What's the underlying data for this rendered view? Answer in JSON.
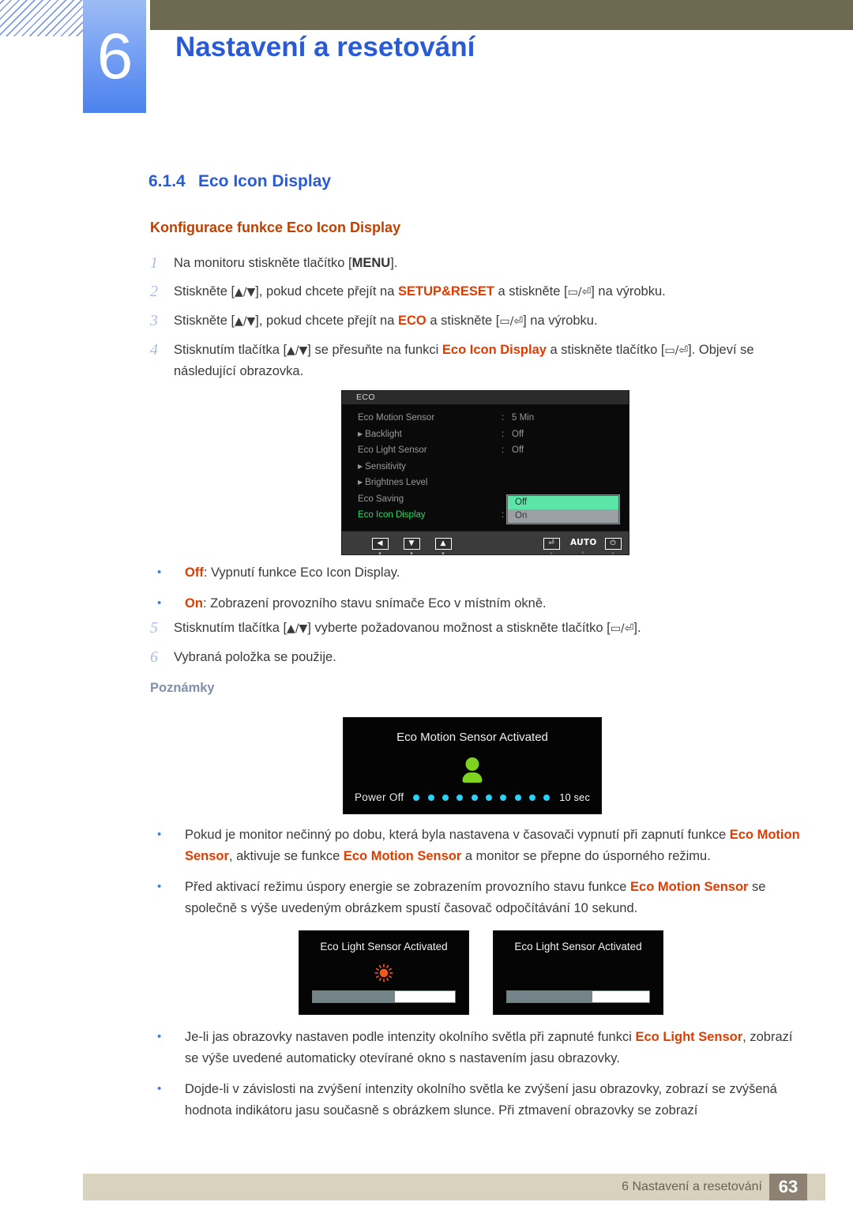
{
  "header": {
    "chapter_number": "6",
    "chapter_title": "Nastavení a resetování"
  },
  "section": {
    "number": "6.1.4",
    "title": "Eco Icon Display",
    "subtitle": "Konfigurace funkce Eco Icon Display"
  },
  "steps": [
    {
      "num": "1",
      "parts": [
        {
          "t": "Na monitoru stiskněte tlačítko [",
          "k": "plain"
        },
        {
          "t": "MENU",
          "k": "kb"
        },
        {
          "t": "].",
          "k": "plain"
        }
      ]
    },
    {
      "num": "2",
      "parts": [
        {
          "t": "Stiskněte [",
          "k": "plain"
        },
        {
          "t": "▲/▼",
          "k": "sym"
        },
        {
          "t": "], pokud chcete přejít na ",
          "k": "plain"
        },
        {
          "t": "SETUP&RESET",
          "k": "hl"
        },
        {
          "t": " a stiskněte [",
          "k": "plain"
        },
        {
          "t": "▭/⏎",
          "k": "sym"
        },
        {
          "t": "] na výrobku.",
          "k": "plain"
        }
      ]
    },
    {
      "num": "3",
      "parts": [
        {
          "t": "Stiskněte [",
          "k": "plain"
        },
        {
          "t": "▲/▼",
          "k": "sym"
        },
        {
          "t": "], pokud chcete přejít na ",
          "k": "plain"
        },
        {
          "t": "ECO",
          "k": "hl"
        },
        {
          "t": " a stiskněte [",
          "k": "plain"
        },
        {
          "t": "▭/⏎",
          "k": "sym"
        },
        {
          "t": "] na výrobku.",
          "k": "plain"
        }
      ]
    },
    {
      "num": "4",
      "parts": [
        {
          "t": "Stisknutím tlačítka [",
          "k": "plain"
        },
        {
          "t": "▲/▼",
          "k": "sym"
        },
        {
          "t": "] se přesuňte na funkci ",
          "k": "plain"
        },
        {
          "t": "Eco Icon Display",
          "k": "hl"
        },
        {
          "t": " a stiskněte tlačítko [",
          "k": "plain"
        },
        {
          "t": "▭/⏎",
          "k": "sym"
        },
        {
          "t": "]. Objeví se následující obrazovka.",
          "k": "plain"
        }
      ]
    }
  ],
  "steps_tail": [
    {
      "num": "5",
      "parts": [
        {
          "t": "Stisknutím tlačítka [",
          "k": "plain"
        },
        {
          "t": "▲/▼",
          "k": "sym"
        },
        {
          "t": "] vyberte požadovanou možnost a stiskněte tlačítko [",
          "k": "plain"
        },
        {
          "t": "▭/⏎",
          "k": "sym"
        },
        {
          "t": "].",
          "k": "plain"
        }
      ]
    },
    {
      "num": "6",
      "parts": [
        {
          "t": "Vybraná položka se použije.",
          "k": "plain"
        }
      ]
    }
  ],
  "osd": {
    "title": "ECO",
    "rows": [
      {
        "label": "Eco Motion Sensor",
        "arrow": false,
        "colon": ":",
        "value": "5 Min",
        "active": false
      },
      {
        "label": "Backlight",
        "arrow": true,
        "colon": ":",
        "value": "Off",
        "active": false
      },
      {
        "label": "Eco Light Sensor",
        "arrow": false,
        "colon": ":",
        "value": "Off",
        "active": false
      },
      {
        "label": "Sensitivity",
        "arrow": true,
        "colon": "",
        "value": "",
        "active": false
      },
      {
        "label": "Brightnes Level",
        "arrow": true,
        "colon": "",
        "value": "",
        "active": false
      },
      {
        "label": "Eco Saving",
        "arrow": false,
        "colon": "",
        "value": "",
        "active": false
      },
      {
        "label": "Eco Icon Display",
        "arrow": false,
        "colon": ":",
        "value": "",
        "active": true
      }
    ],
    "dropdown": {
      "selected": "Off",
      "other": "On"
    },
    "buttons": [
      {
        "glyph": "◀",
        "caret": "▾",
        "bright": true
      },
      {
        "glyph": "▼",
        "caret": "▾",
        "bright": true
      },
      {
        "glyph": "▲",
        "caret": "▾",
        "bright": true
      },
      {
        "glyph": "⏎",
        "caret": "▾",
        "bright": false
      },
      {
        "glyph": "AUTO",
        "caret": "▾",
        "bright": false
      },
      {
        "glyph": "⏻",
        "caret": "▾",
        "bright": false
      }
    ]
  },
  "option_bullets": [
    {
      "parts": [
        {
          "t": "Off",
          "k": "hl"
        },
        {
          "t": ": Vypnutí funkce Eco Icon Display.",
          "k": "plain"
        }
      ]
    },
    {
      "parts": [
        {
          "t": "On",
          "k": "hl"
        },
        {
          "t": ": Zobrazení provozního stavu snímače Eco v místním okně.",
          "k": "plain"
        }
      ]
    }
  ],
  "notes_heading": "Poznámky",
  "motion_panel": {
    "title": "Eco Motion Sensor Activated",
    "power_off_label": "Power Off",
    "seconds_label": "10 sec",
    "dot_count": 10,
    "icon": "person-icon",
    "icon_color": "#7ed321",
    "dot_color": "#2ad2f5"
  },
  "note_bullets_upper": [
    {
      "parts": [
        {
          "t": "Pokud je monitor nečinný po dobu, která byla nastavena v časovači vypnutí při zapnutí funkce ",
          "k": "plain"
        },
        {
          "t": "Eco Motion Sensor",
          "k": "hl"
        },
        {
          "t": ", aktivuje se funkce ",
          "k": "plain"
        },
        {
          "t": "Eco Motion Sensor",
          "k": "hl"
        },
        {
          "t": " a monitor se přepne do úsporného režimu.",
          "k": "plain"
        }
      ]
    },
    {
      "parts": [
        {
          "t": "Před aktivací režimu úspory energie se zobrazením provozního stavu funkce ",
          "k": "plain"
        },
        {
          "t": "Eco Motion Sensor",
          "k": "hl"
        },
        {
          "t": " se společně s výše uvedeným obrázkem spustí časovač odpočítávání 10 sekund.",
          "k": "plain"
        }
      ]
    }
  ],
  "light_panels": [
    {
      "title": "Eco Light Sensor Activated",
      "icon": "sun-icon",
      "icon_color": "#f4581a",
      "fill_percent": 58
    },
    {
      "title": "Eco Light Sensor Activated",
      "icon": "moon-icon",
      "icon_color": "#f2c12a",
      "fill_percent": 60
    }
  ],
  "note_bullets_lower": [
    {
      "parts": [
        {
          "t": "Je-li jas obrazovky nastaven podle intenzity okolního světla při zapnuté funkci ",
          "k": "plain"
        },
        {
          "t": "Eco Light Sensor",
          "k": "hl"
        },
        {
          "t": ", zobrazí se výše uvedené automaticky otevírané okno s nastavením jasu obrazovky.",
          "k": "plain"
        }
      ]
    },
    {
      "parts": [
        {
          "t": "Dojde-li v závislosti na zvýšení intenzity okolního světla ke zvýšení jasu obrazovky, zobrazí se zvýšená hodnota indikátoru jasu současně s obrázkem slunce. Při ztmavení obrazovky se zobrazí",
          "k": "plain"
        }
      ]
    }
  ],
  "footer": {
    "text": "6 Nastavení a resetování",
    "page": "63"
  },
  "colors": {
    "accent_blue": "#2a5bd7",
    "accent_orange": "#c04000",
    "highlight_orange": "#e03c00",
    "olive": "#6e6a52",
    "footer_beige": "#d8d2bf",
    "footer_brown": "#8d8173",
    "osd_green": "#22dd66",
    "dropdown_green": "#5be6a8"
  }
}
